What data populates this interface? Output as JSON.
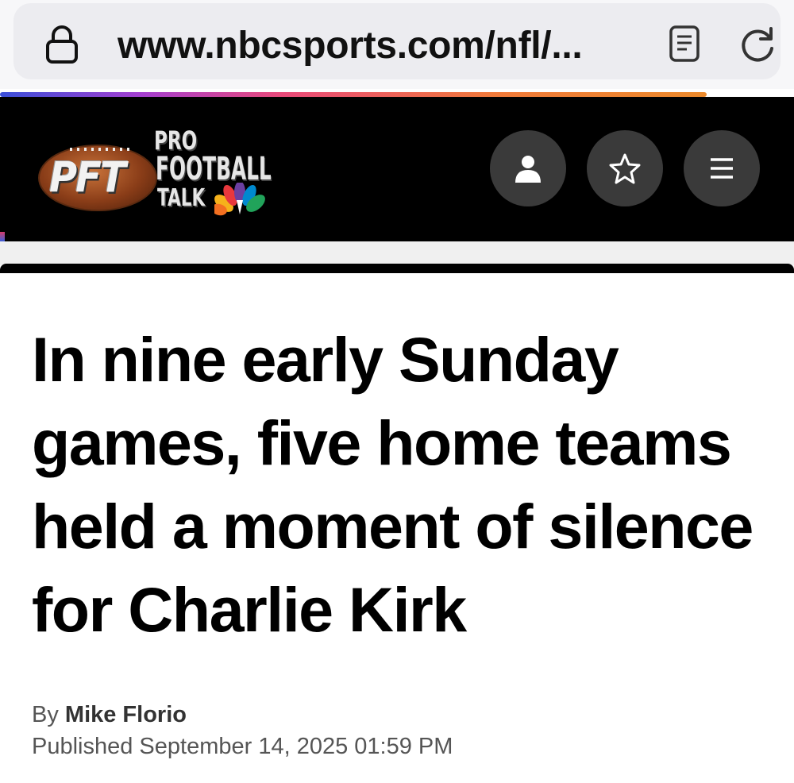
{
  "browser": {
    "url": "www.nbcsports.com/nfl/...",
    "lock_icon": "lock-icon",
    "reader_icon": "reader-mode-icon",
    "reload_icon": "reload-icon",
    "load_progress": 0.89
  },
  "header": {
    "logo": {
      "initials": "PFT",
      "line1": "PRO",
      "line2": "FOOTBALL",
      "line3": "TALK"
    },
    "buttons": [
      {
        "icon": "account-icon"
      },
      {
        "icon": "star-icon"
      },
      {
        "icon": "menu-icon"
      }
    ]
  },
  "article": {
    "headline": "In nine early Sunday games, five home teams held a moment of silence for Charlie Kirk",
    "byline_prefix": "By",
    "author": "Mike Florio",
    "published": "Published September 14, 2025 01:59 PM"
  },
  "colors": {
    "header_bg": "#000000",
    "header_button_bg": "#3a3a3a",
    "address_pill_bg": "#ececf0"
  }
}
